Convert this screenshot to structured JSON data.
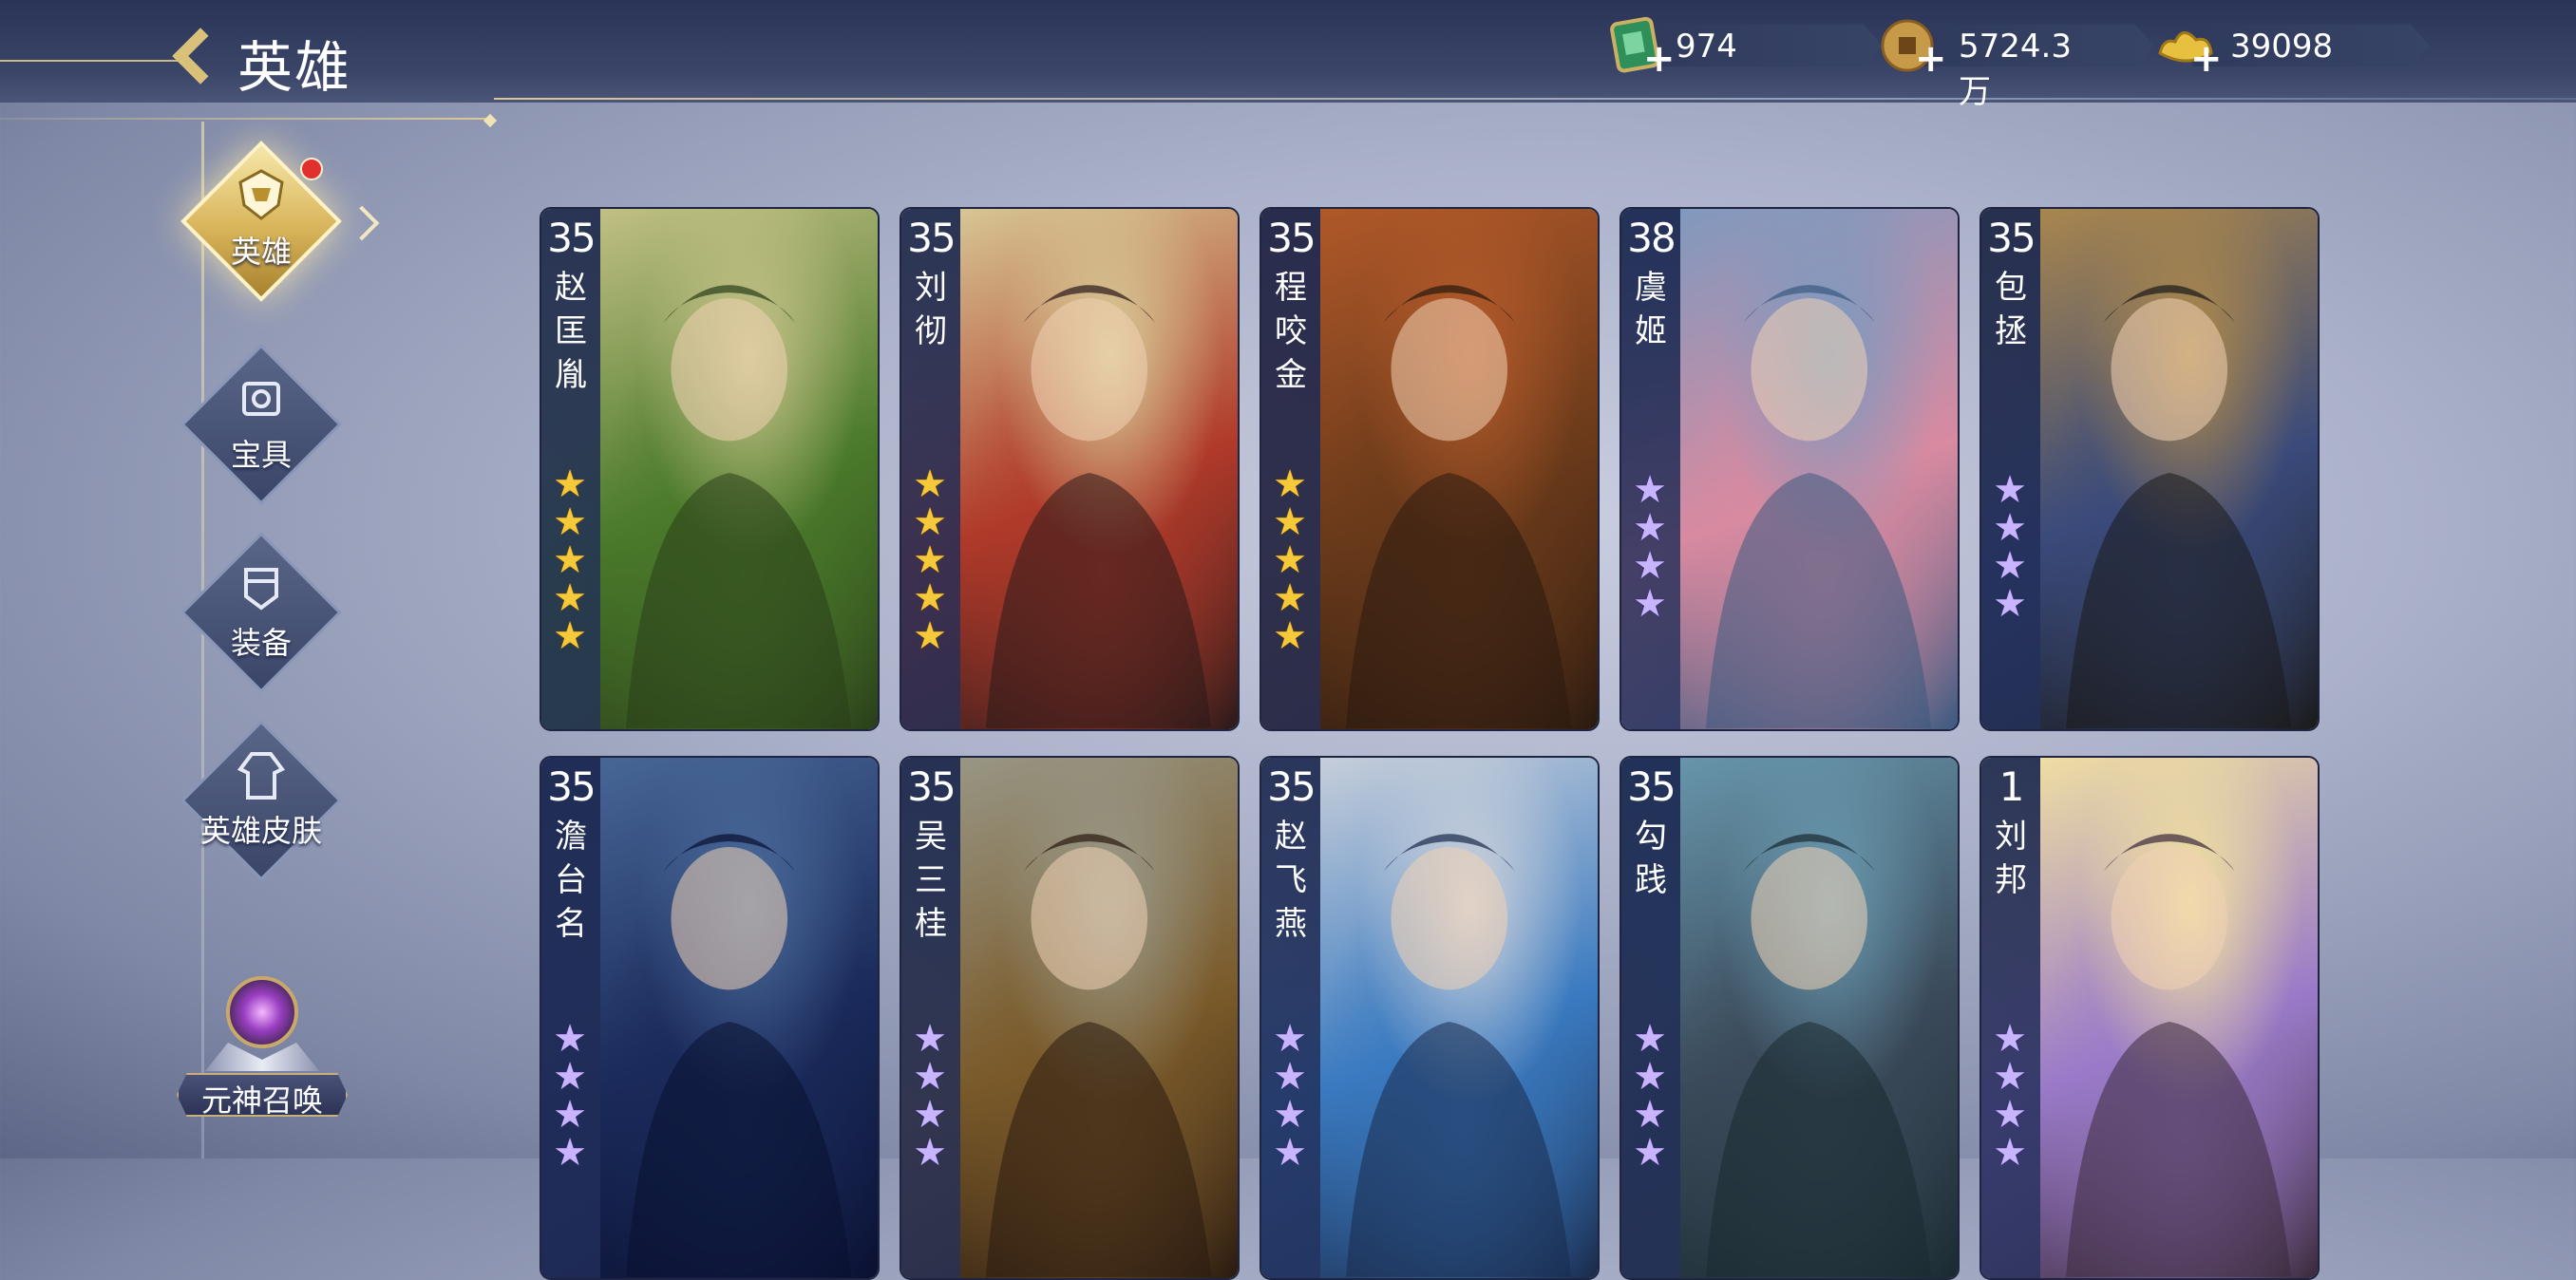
{
  "header": {
    "title": "英雄",
    "resources": [
      {
        "name": "jade-ticket",
        "value": "974",
        "color": "#3aa56a"
      },
      {
        "name": "copper-coin",
        "value": "5724.3万",
        "color": "#c79a4a"
      },
      {
        "name": "gold-ingot",
        "value": "39098",
        "color": "#e8c040"
      }
    ]
  },
  "sidebar": {
    "items": [
      {
        "label": "英雄",
        "icon": "hero-helmet-icon",
        "active": true
      },
      {
        "label": "宝具",
        "icon": "treasure-icon",
        "active": false
      },
      {
        "label": "装备",
        "icon": "armor-icon",
        "active": false
      },
      {
        "label": "英雄皮肤",
        "icon": "robe-icon",
        "active": false
      }
    ],
    "summon_label": "元神召唤"
  },
  "heroes": [
    {
      "level": "35",
      "name": "赵匡胤",
      "stars": 5,
      "star_color": "gold",
      "theme": [
        "#c9c48a",
        "#4a7a2a",
        "#2a3e1a"
      ]
    },
    {
      "level": "35",
      "name": "刘彻",
      "stars": 5,
      "star_color": "gold",
      "theme": [
        "#d9cf9a",
        "#b03a2a",
        "#2a1a1a"
      ]
    },
    {
      "level": "35",
      "name": "程咬金",
      "stars": 5,
      "star_color": "gold",
      "theme": [
        "#b45a2a",
        "#6a3a1a",
        "#2a1a10"
      ]
    },
    {
      "level": "38",
      "name": "虞姬",
      "stars": 4,
      "star_color": "purple",
      "theme": [
        "#7a9ac0",
        "#d88aa0",
        "#3a5a80"
      ]
    },
    {
      "level": "35",
      "name": "包拯",
      "stars": 4,
      "star_color": "purple",
      "theme": [
        "#b08a4a",
        "#3a4a7a",
        "#1a1a1a"
      ]
    },
    {
      "level": "35",
      "name": "澹台名",
      "stars": 4,
      "star_color": "purple",
      "theme": [
        "#4a6a9a",
        "#1a2a5a",
        "#0a1030"
      ]
    },
    {
      "level": "35",
      "name": "吴三桂",
      "stars": 4,
      "star_color": "purple",
      "theme": [
        "#9a9a8a",
        "#7a5a2a",
        "#2a1a10"
      ]
    },
    {
      "level": "35",
      "name": "赵飞燕",
      "stars": 4,
      "star_color": "purple",
      "theme": [
        "#d0d4dc",
        "#3a7ac0",
        "#1a2a4a"
      ]
    },
    {
      "level": "35",
      "name": "勾践",
      "stars": 4,
      "star_color": "purple",
      "theme": [
        "#6a9ab0",
        "#3a4a5a",
        "#1a2a30"
      ]
    },
    {
      "level": "1",
      "name": "刘邦",
      "stars": 4,
      "star_color": "purple",
      "theme": [
        "#f4e4a0",
        "#9a7ac8",
        "#3a2a3a"
      ]
    }
  ]
}
